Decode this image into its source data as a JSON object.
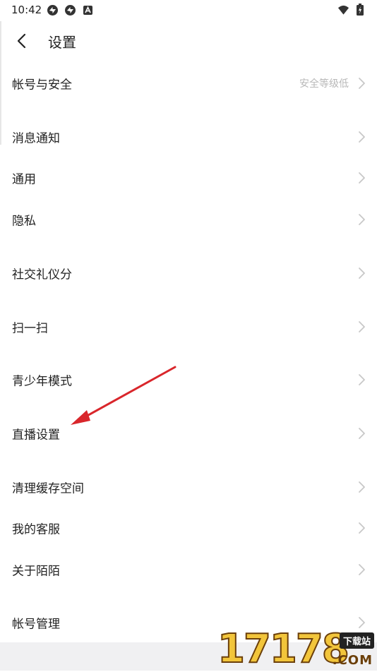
{
  "status_bar": {
    "time": "10:42",
    "left_icons": [
      "sync-icon",
      "sync-icon",
      "app-notification-icon"
    ],
    "right_icons": [
      "wifi-icon",
      "battery-charging-icon"
    ]
  },
  "nav": {
    "back_icon": "chevron-left-icon",
    "title": "设置"
  },
  "settings": [
    {
      "id": "account-security",
      "label": "帐号与安全",
      "value": "安全等级低"
    },
    {
      "id": "notifications",
      "label": "消息通知",
      "value": ""
    },
    {
      "id": "general",
      "label": "通用",
      "value": ""
    },
    {
      "id": "privacy",
      "label": "隐私",
      "value": ""
    },
    {
      "id": "social-etiquette",
      "label": "社交礼仪分",
      "value": ""
    },
    {
      "id": "scan",
      "label": "扫一扫",
      "value": ""
    },
    {
      "id": "teen-mode",
      "label": "青少年模式",
      "value": ""
    },
    {
      "id": "live-settings",
      "label": "直播设置",
      "value": ""
    },
    {
      "id": "clear-cache",
      "label": "清理缓存空间",
      "value": ""
    },
    {
      "id": "customer-service",
      "label": "我的客服",
      "value": ""
    },
    {
      "id": "about",
      "label": "关于陌陌",
      "value": ""
    },
    {
      "id": "account-management",
      "label": "帐号管理",
      "value": ""
    }
  ],
  "annotation": {
    "color": "#d9262b"
  },
  "watermark": {
    "digits": "17178",
    "tag": "下载站",
    "suffix": ".COM"
  },
  "colors": {
    "text": "#222222",
    "secondary_text": "#b8b8b8",
    "chevron": "#c8c8c8",
    "bottom_bar": "#f0f0f2"
  }
}
